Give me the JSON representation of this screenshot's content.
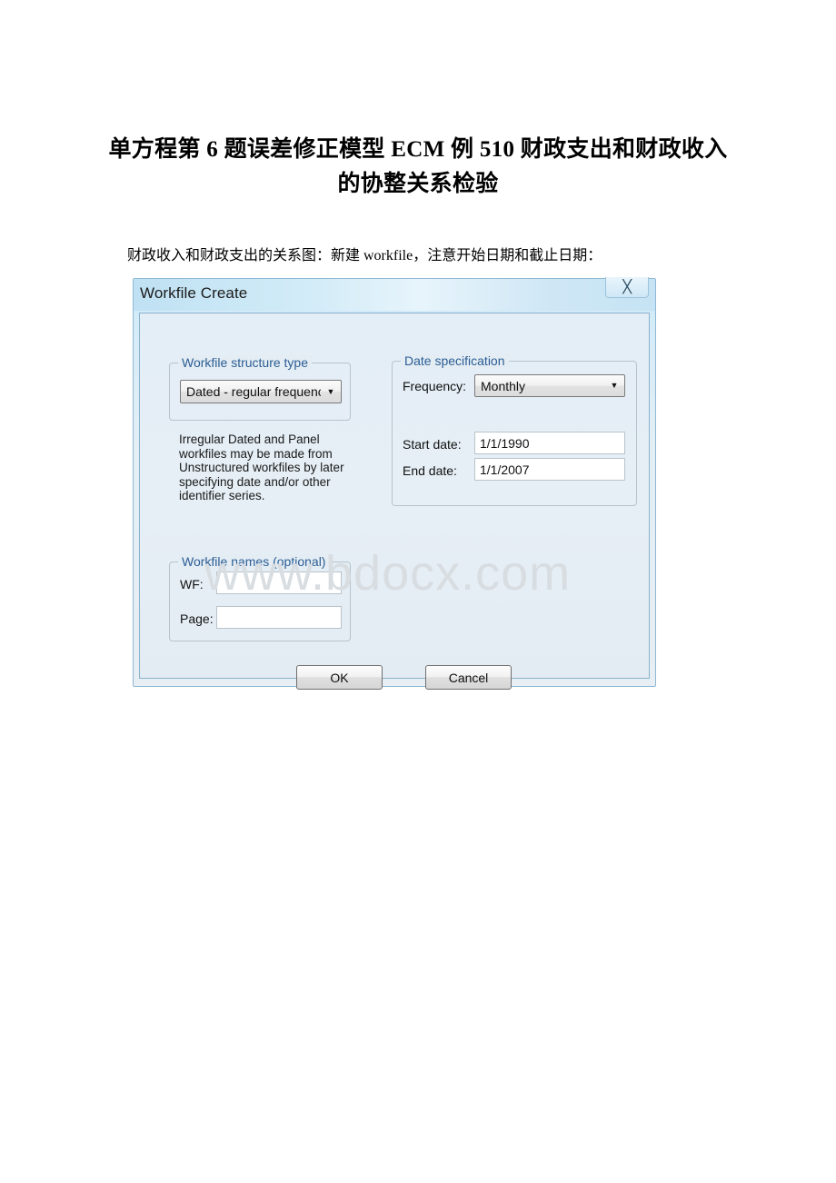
{
  "document": {
    "title": "单方程第 6 题误差修正模型 ECM 例 510 财政支出和财政收入的协整关系检验",
    "paragraph": "财政收入和财政支出的关系图：新建 workfile，注意开始日期和截止日期："
  },
  "watermark": {
    "text": "www.bdocx.com",
    "color": "#d8dde2"
  },
  "dialog": {
    "title": "Workfile Create",
    "close_icon": "close-icon",
    "titlebar_color": "#cfe9f7",
    "body_color": "#e5eef5",
    "legend_color": "#2b5d94",
    "structure_group": {
      "legend": "Workfile structure type",
      "combo": {
        "value": "Dated - regular frequency",
        "arrow_icon": "chevron-down-icon"
      }
    },
    "description": "Irregular Dated and Panel workfiles may be made from Unstructured workfiles by later specifying date and/or other identifier series.",
    "date_group": {
      "legend": "Date specification",
      "frequency_label": "Frequency:",
      "frequency_value": "Monthly",
      "frequency_arrow_icon": "chevron-down-icon",
      "start_label": "Start date:",
      "start_value": "1/1/1990",
      "end_label": "End date:",
      "end_value": "1/1/2007"
    },
    "names_group": {
      "legend": "Workfile names (optional)",
      "wf_label": "WF:",
      "wf_value": "",
      "page_label": "Page:",
      "page_value": ""
    },
    "buttons": {
      "ok": "OK",
      "cancel": "Cancel"
    }
  }
}
